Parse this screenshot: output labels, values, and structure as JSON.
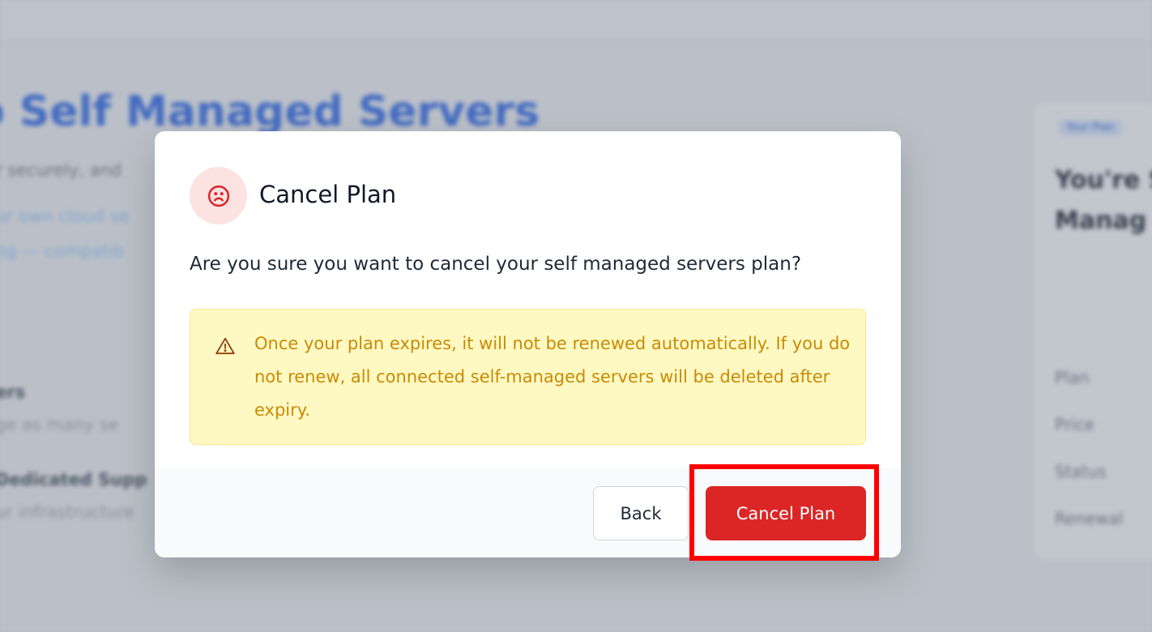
{
  "background": {
    "breadcrumb": "",
    "heading": "o Self Managed Servers",
    "lines": [
      {
        "text": "r securely, and",
        "color": "#6b7280"
      },
      {
        "text": "ur own cloud se",
        "color": "#93c5fd"
      },
      {
        "text": "ng — compatib",
        "color": "#93c5fd"
      },
      {
        "text": "ers",
        "color": "#374151"
      },
      {
        "text": "ge as many se",
        "color": "#9ca3af"
      },
      {
        "text": "Dedicated Supp",
        "color": "#374151"
      },
      {
        "text": "ur infrastructure",
        "color": "#9ca3af"
      }
    ],
    "card": {
      "badge": "Your Plan",
      "title": "You're S\nManag",
      "rows": [
        "Plan",
        "Price",
        "Status",
        "Renewal"
      ]
    }
  },
  "modal": {
    "icon": "sad-face-icon",
    "title": "Cancel Plan",
    "message": "Are you sure you want to cancel your self managed servers plan?",
    "warning": {
      "icon": "warning-triangle-icon",
      "text": "Once your plan expires, it will not be renewed automatically. If you do not renew, all connected self-managed servers will be deleted after expiry."
    },
    "back_label": "Back",
    "cancel_label": "Cancel Plan"
  },
  "colors": {
    "danger": "#dc2626",
    "danger_soft": "#fde2e2",
    "warning_bg": "#fef9c3",
    "warning_text": "#ca8a04",
    "highlight": "#ff0000"
  }
}
